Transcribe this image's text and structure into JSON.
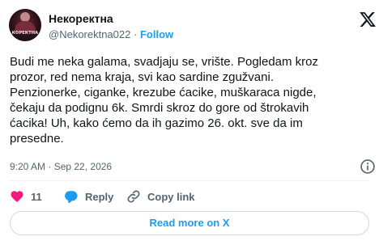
{
  "author": {
    "display_name": "Некоректна",
    "handle": "@Nekorektna022",
    "separator": "·",
    "follow_label": "Follow",
    "avatar_text": "КОРЕКТНА"
  },
  "tweet": {
    "lines": [
      "Budi me neka galama, svadjaju se, vrište. Pogledam kroz",
      "prozor, red nema kraja, svi kao sardine zgužvani.",
      "Penzionerke, ciganke, krezube ćacike, muškaraca nigde,",
      "čekaju da podignu 6k. Smrdi skroz do gore od štrokavih",
      "ćacika! Uh, kako ćemo da ih gazimo 26. okt. sve da im",
      "presedne."
    ],
    "timestamp": "9:20 AM · Sep 22, 2026"
  },
  "actions": {
    "like_count": "11",
    "reply_label": "Reply",
    "copy_link_label": "Copy link"
  },
  "read_more_label": "Read more on X",
  "colors": {
    "accent": "#1d9bf0",
    "like": "#f91880",
    "secondary_text": "#536471",
    "border": "#cfd9de"
  }
}
